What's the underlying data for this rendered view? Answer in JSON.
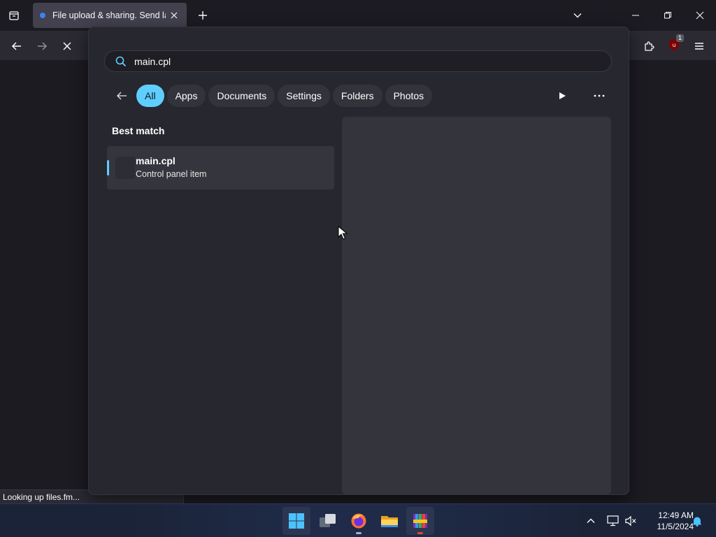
{
  "browser": {
    "tab_title": "File upload & sharing. Send large files",
    "status_text": "Looking up files.fm...",
    "extension_badge": "1"
  },
  "search": {
    "query": "main.cpl",
    "filters": [
      {
        "label": "All",
        "active": true
      },
      {
        "label": "Apps"
      },
      {
        "label": "Documents"
      },
      {
        "label": "Settings"
      },
      {
        "label": "Folders"
      },
      {
        "label": "Photos"
      }
    ],
    "best_match_label": "Best match",
    "result": {
      "name": "main.cpl",
      "type": "Control panel item"
    }
  },
  "taskbar": {
    "apps": [
      "start-icon",
      "task-view-icon",
      "firefox-icon",
      "file-explorer-icon",
      "winrar-icon"
    ],
    "time": "12:49 AM",
    "date": "11/5/2024"
  },
  "colors": {
    "accent": "#60cdff",
    "panel": "#272730",
    "taskbar": "#1b2338"
  }
}
